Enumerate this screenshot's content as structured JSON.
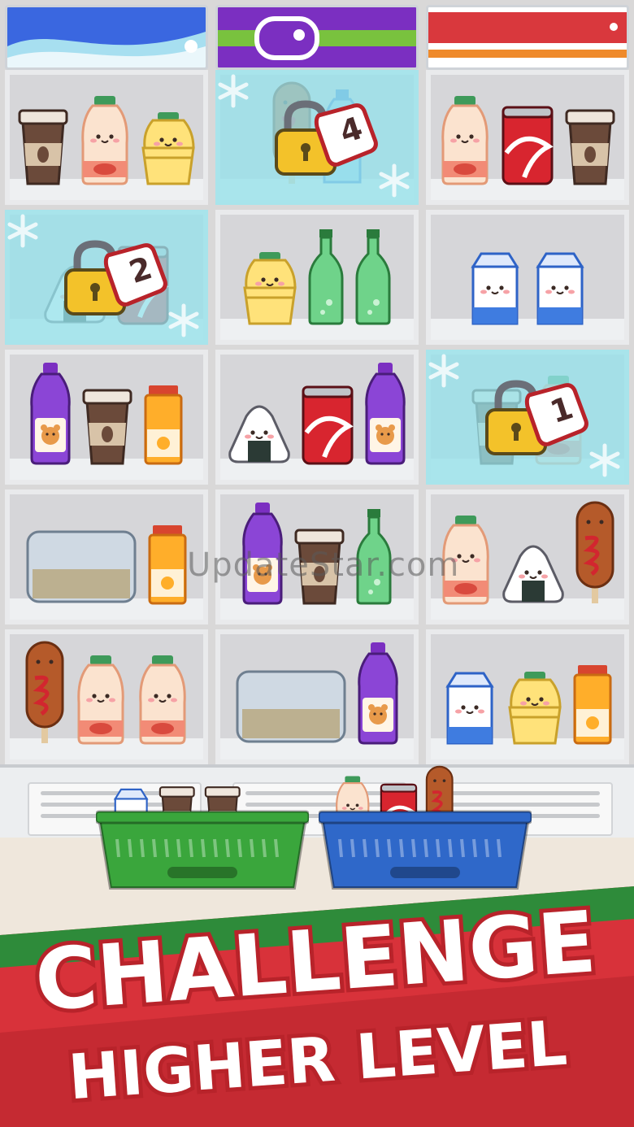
{
  "banner": {
    "line1": "CHALLENGE",
    "line2": "HIGHER LEVEL"
  },
  "watermark": "UpdateStar.com",
  "locks": [
    {
      "name": "lock-4",
      "count": "4"
    },
    {
      "name": "lock-2",
      "count": "2"
    },
    {
      "name": "lock-1",
      "count": "1"
    }
  ],
  "colors": {
    "banner_red": "#d8323a",
    "banner_green": "#2e8b3a",
    "store_blue": "#3a67e0",
    "store_purple": "#7b2fc1",
    "store_green": "#79c23e",
    "store_red": "#d9383d",
    "store_orange": "#ef8a2b",
    "ice": "#9be2ec"
  },
  "shelves": [
    {
      "row": 1,
      "col": 1,
      "items": [
        "coffee-cup",
        "yogurt-bottle",
        "pudding-cup"
      ]
    },
    {
      "row": 1,
      "col": 2,
      "frozen": true,
      "locked": "4",
      "items": [
        "corn-dog",
        "water-bottle"
      ]
    },
    {
      "row": 1,
      "col": 3,
      "items": [
        "yogurt-bottle",
        "cola-can",
        "coffee-cup"
      ]
    },
    {
      "row": 2,
      "col": 1,
      "frozen": true,
      "locked": "2",
      "items": [
        "onigiri",
        "cola-can"
      ]
    },
    {
      "row": 2,
      "col": 2,
      "items": [
        "pudding-cup",
        "green-soda-bottle",
        "green-soda-bottle"
      ]
    },
    {
      "row": 2,
      "col": 3,
      "items": [
        "milk-carton",
        "milk-carton"
      ]
    },
    {
      "row": 3,
      "col": 1,
      "items": [
        "grape-juice-bottle",
        "coffee-cup",
        "orange-juice-bottle"
      ]
    },
    {
      "row": 3,
      "col": 2,
      "items": [
        "onigiri",
        "cola-can",
        "grape-juice-bottle"
      ]
    },
    {
      "row": 3,
      "col": 3,
      "frozen": true,
      "locked": "1",
      "items": [
        "coffee-cup",
        "yogurt-bottle"
      ]
    },
    {
      "row": 4,
      "col": 1,
      "items": [
        "juice-pack",
        "orange-juice-bottle"
      ]
    },
    {
      "row": 4,
      "col": 2,
      "items": [
        "grape-juice-bottle",
        "coffee-cup",
        "green-soda-bottle"
      ]
    },
    {
      "row": 4,
      "col": 3,
      "items": [
        "yogurt-bottle",
        "onigiri",
        "corn-dog"
      ]
    },
    {
      "row": 5,
      "col": 1,
      "items": [
        "corn-dog",
        "yogurt-bottle",
        "yogurt-bottle"
      ]
    },
    {
      "row": 5,
      "col": 2,
      "items": [
        "juice-pack",
        "grape-juice-bottle"
      ]
    },
    {
      "row": 5,
      "col": 3,
      "items": [
        "milk-carton",
        "pudding-cup",
        "orange-juice-bottle"
      ]
    }
  ],
  "baskets": [
    {
      "name": "green-basket",
      "color": "#3aa63c",
      "items": [
        "milk-carton",
        "coffee-cup",
        "coffee-cup"
      ]
    },
    {
      "name": "blue-basket",
      "color": "#2f68c9",
      "items": [
        "yogurt-bottle",
        "cola-can",
        "corn-dog"
      ]
    }
  ]
}
